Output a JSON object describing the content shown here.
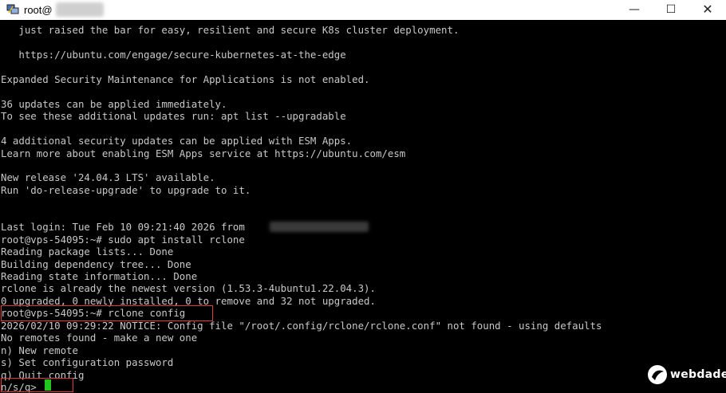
{
  "window": {
    "title": "root@",
    "minimize": "—",
    "maximize": "☐",
    "close": "✕"
  },
  "terminal": {
    "lines": [
      "   just raised the bar for easy, resilient and secure K8s cluster deployment.",
      "",
      "   https://ubuntu.com/engage/secure-kubernetes-at-the-edge",
      "",
      "Expanded Security Maintenance for Applications is not enabled.",
      "",
      "36 updates can be applied immediately.",
      "To see these additional updates run: apt list --upgradable",
      "",
      "4 additional security updates can be applied with ESM Apps.",
      "Learn more about enabling ESM Apps service at https://ubuntu.com/esm",
      "",
      "New release '24.04.3 LTS' available.",
      "Run 'do-release-upgrade' to upgrade to it.",
      "",
      "",
      "Last login: Tue Feb 10 09:21:40 2026 from",
      "root@vps-54095:~# sudo apt install rclone",
      "Reading package lists... Done",
      "Building dependency tree... Done",
      "Reading state information... Done",
      "rclone is already the newest version (1.53.3-4ubuntu1.22.04.3).",
      "0 upgraded, 0 newly installed, 0 to remove and 32 not upgraded.",
      "root@vps-54095:~# rclone config",
      "2026/02/10 09:29:22 NOTICE: Config file \"/root/.config/rclone/rclone.conf\" not found - using defaults",
      "No remotes found - make a new one",
      "n) New remote",
      "s) Set configuration password",
      "q) Quit config",
      "n/s/q> "
    ]
  },
  "watermark": {
    "text": "webdade"
  },
  "colors": {
    "text": "#c8c8c8",
    "cursor": "#22c51e",
    "highlight": "#e03b3b"
  }
}
